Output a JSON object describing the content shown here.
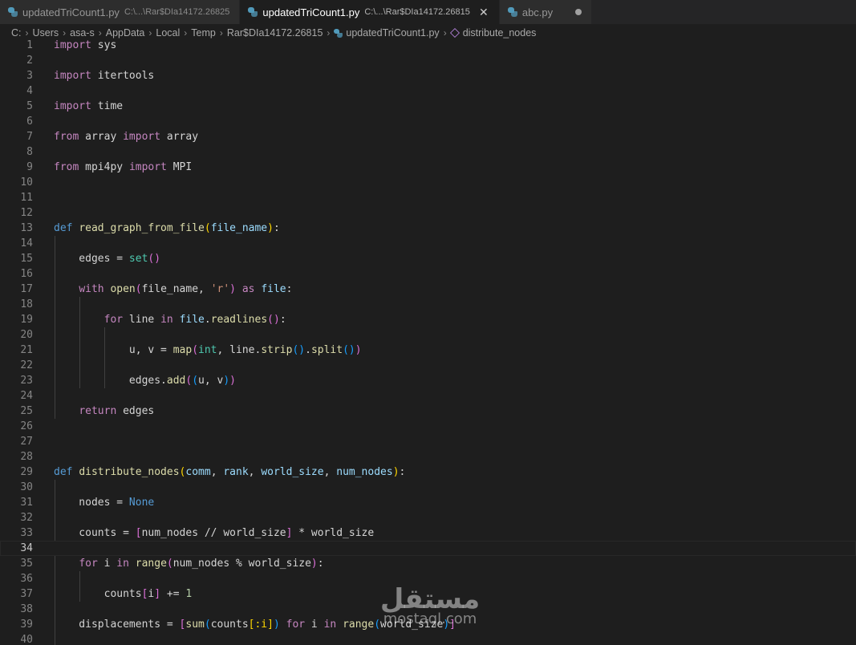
{
  "tabs": [
    {
      "filename": "updatedTriCount1.py",
      "path": "C:\\...\\Rar$DIa14172.26825",
      "active": false
    },
    {
      "filename": "updatedTriCount1.py",
      "path": "C:\\...\\Rar$DIa14172.26815",
      "active": true,
      "close": "✕"
    },
    {
      "filename": "abc.py",
      "path": "",
      "active": false,
      "dirty": true
    }
  ],
  "breadcrumb": {
    "parts": [
      "C:",
      "Users",
      "asa-s",
      "AppData",
      "Local",
      "Temp",
      "Rar$DIa14172.26815"
    ],
    "file": "updatedTriCount1.py",
    "symbol": "distribute_nodes"
  },
  "editor": {
    "current_line": 34,
    "lines": [
      {
        "n": 1,
        "indent": 0,
        "tokens": [
          [
            "kw",
            "import"
          ],
          [
            "tx",
            " sys"
          ]
        ]
      },
      {
        "n": 2,
        "indent": 0,
        "tokens": []
      },
      {
        "n": 3,
        "indent": 0,
        "tokens": [
          [
            "kw",
            "import"
          ],
          [
            "tx",
            " itertools"
          ]
        ]
      },
      {
        "n": 4,
        "indent": 0,
        "tokens": []
      },
      {
        "n": 5,
        "indent": 0,
        "tokens": [
          [
            "kw",
            "import"
          ],
          [
            "tx",
            " time"
          ]
        ]
      },
      {
        "n": 6,
        "indent": 0,
        "tokens": []
      },
      {
        "n": 7,
        "indent": 0,
        "tokens": [
          [
            "kw",
            "from"
          ],
          [
            "tx",
            " array "
          ],
          [
            "kw",
            "import"
          ],
          [
            "tx",
            " array"
          ]
        ]
      },
      {
        "n": 8,
        "indent": 0,
        "tokens": []
      },
      {
        "n": 9,
        "indent": 0,
        "tokens": [
          [
            "kw",
            "from"
          ],
          [
            "tx",
            " mpi4py "
          ],
          [
            "kw",
            "import"
          ],
          [
            "tx",
            " MPI"
          ]
        ]
      },
      {
        "n": 10,
        "indent": 0,
        "tokens": []
      },
      {
        "n": 11,
        "indent": 0,
        "tokens": []
      },
      {
        "n": 12,
        "indent": 0,
        "tokens": []
      },
      {
        "n": 13,
        "indent": 0,
        "tokens": [
          [
            "def",
            "def"
          ],
          [
            "tx",
            " "
          ],
          [
            "fn",
            "read_graph_from_file"
          ],
          [
            "b1",
            "("
          ],
          [
            "pm",
            "file_name"
          ],
          [
            "b1",
            ")"
          ],
          [
            "tx",
            ":"
          ]
        ]
      },
      {
        "n": 14,
        "indent": 1,
        "tokens": []
      },
      {
        "n": 15,
        "indent": 1,
        "tokens": [
          [
            "tx",
            "    edges = "
          ],
          [
            "bi",
            "set"
          ],
          [
            "b2",
            "()"
          ]
        ]
      },
      {
        "n": 16,
        "indent": 1,
        "tokens": []
      },
      {
        "n": 17,
        "indent": 1,
        "tokens": [
          [
            "tx",
            "    "
          ],
          [
            "kw",
            "with"
          ],
          [
            "tx",
            " "
          ],
          [
            "fn",
            "open"
          ],
          [
            "b2",
            "("
          ],
          [
            "tx",
            "file_name, "
          ],
          [
            "st",
            "'r'"
          ],
          [
            "b2",
            ")"
          ],
          [
            "tx",
            " "
          ],
          [
            "kw",
            "as"
          ],
          [
            "tx",
            " "
          ],
          [
            "pm",
            "file"
          ],
          [
            "tx",
            ":"
          ]
        ]
      },
      {
        "n": 18,
        "indent": 2,
        "tokens": []
      },
      {
        "n": 19,
        "indent": 2,
        "tokens": [
          [
            "tx",
            "        "
          ],
          [
            "kw",
            "for"
          ],
          [
            "tx",
            " line "
          ],
          [
            "kw",
            "in"
          ],
          [
            "tx",
            " "
          ],
          [
            "pm",
            "file"
          ],
          [
            "tx",
            "."
          ],
          [
            "fn",
            "readlines"
          ],
          [
            "b2",
            "()"
          ],
          [
            "tx",
            ":"
          ]
        ]
      },
      {
        "n": 20,
        "indent": 3,
        "tokens": []
      },
      {
        "n": 21,
        "indent": 3,
        "tokens": [
          [
            "tx",
            "            u, v = "
          ],
          [
            "fn",
            "map"
          ],
          [
            "b2",
            "("
          ],
          [
            "bi",
            "int"
          ],
          [
            "tx",
            ", line."
          ],
          [
            "fn",
            "strip"
          ],
          [
            "b3",
            "()"
          ],
          [
            "tx",
            "."
          ],
          [
            "fn",
            "split"
          ],
          [
            "b3",
            "()"
          ],
          [
            "b2",
            ")"
          ]
        ]
      },
      {
        "n": 22,
        "indent": 3,
        "tokens": []
      },
      {
        "n": 23,
        "indent": 3,
        "tokens": [
          [
            "tx",
            "            edges."
          ],
          [
            "fn",
            "add"
          ],
          [
            "b2",
            "("
          ],
          [
            "b3",
            "("
          ],
          [
            "tx",
            "u, v"
          ],
          [
            "b3",
            ")"
          ],
          [
            "b2",
            ")"
          ]
        ]
      },
      {
        "n": 24,
        "indent": 1,
        "tokens": []
      },
      {
        "n": 25,
        "indent": 1,
        "tokens": [
          [
            "tx",
            "    "
          ],
          [
            "kw",
            "return"
          ],
          [
            "tx",
            " edges"
          ]
        ]
      },
      {
        "n": 26,
        "indent": 0,
        "tokens": []
      },
      {
        "n": 27,
        "indent": 0,
        "tokens": []
      },
      {
        "n": 28,
        "indent": 0,
        "tokens": []
      },
      {
        "n": 29,
        "indent": 0,
        "tokens": [
          [
            "def",
            "def"
          ],
          [
            "tx",
            " "
          ],
          [
            "fn",
            "distribute_nodes"
          ],
          [
            "b1",
            "("
          ],
          [
            "pm",
            "comm"
          ],
          [
            "tx",
            ", "
          ],
          [
            "pm",
            "rank"
          ],
          [
            "tx",
            ", "
          ],
          [
            "pm",
            "world_size"
          ],
          [
            "tx",
            ", "
          ],
          [
            "pm",
            "num_nodes"
          ],
          [
            "b1",
            ")"
          ],
          [
            "tx",
            ":"
          ]
        ]
      },
      {
        "n": 30,
        "indent": 1,
        "tokens": []
      },
      {
        "n": 31,
        "indent": 1,
        "tokens": [
          [
            "tx",
            "    nodes = "
          ],
          [
            "cn",
            "None"
          ]
        ]
      },
      {
        "n": 32,
        "indent": 1,
        "tokens": []
      },
      {
        "n": 33,
        "indent": 1,
        "tokens": [
          [
            "tx",
            "    counts = "
          ],
          [
            "b2",
            "["
          ],
          [
            "tx",
            "num_nodes // world_size"
          ],
          [
            "b2",
            "]"
          ],
          [
            "tx",
            " * world_size"
          ]
        ]
      },
      {
        "n": 34,
        "indent": 0,
        "tokens": []
      },
      {
        "n": 35,
        "indent": 1,
        "tokens": [
          [
            "tx",
            "    "
          ],
          [
            "kw",
            "for"
          ],
          [
            "tx",
            " i "
          ],
          [
            "kw",
            "in"
          ],
          [
            "tx",
            " "
          ],
          [
            "fn",
            "range"
          ],
          [
            "b2",
            "("
          ],
          [
            "tx",
            "num_nodes % world_size"
          ],
          [
            "b2",
            ")"
          ],
          [
            "tx",
            ":"
          ]
        ]
      },
      {
        "n": 36,
        "indent": 2,
        "tokens": []
      },
      {
        "n": 37,
        "indent": 2,
        "tokens": [
          [
            "tx",
            "        counts"
          ],
          [
            "b2",
            "["
          ],
          [
            "tx",
            "i"
          ],
          [
            "b2",
            "]"
          ],
          [
            "tx",
            " += "
          ],
          [
            "nm",
            "1"
          ]
        ]
      },
      {
        "n": 38,
        "indent": 1,
        "tokens": []
      },
      {
        "n": 39,
        "indent": 1,
        "tokens": [
          [
            "tx",
            "    displacements = "
          ],
          [
            "b2",
            "["
          ],
          [
            "fn",
            "sum"
          ],
          [
            "b3",
            "("
          ],
          [
            "tx",
            "counts"
          ],
          [
            "b1",
            "[:i]"
          ],
          [
            "b3",
            ")"
          ],
          [
            "tx",
            " "
          ],
          [
            "kw",
            "for"
          ],
          [
            "tx",
            " i "
          ],
          [
            "kw",
            "in"
          ],
          [
            "tx",
            " "
          ],
          [
            "fn",
            "range"
          ],
          [
            "b3",
            "("
          ],
          [
            "tx",
            "world_size"
          ],
          [
            "b3",
            ")"
          ],
          [
            "b2",
            "]"
          ]
        ]
      },
      {
        "n": 40,
        "indent": 1,
        "tokens": []
      }
    ]
  },
  "watermark": {
    "arabic": "مستقل",
    "latin": "mostaql.com"
  }
}
